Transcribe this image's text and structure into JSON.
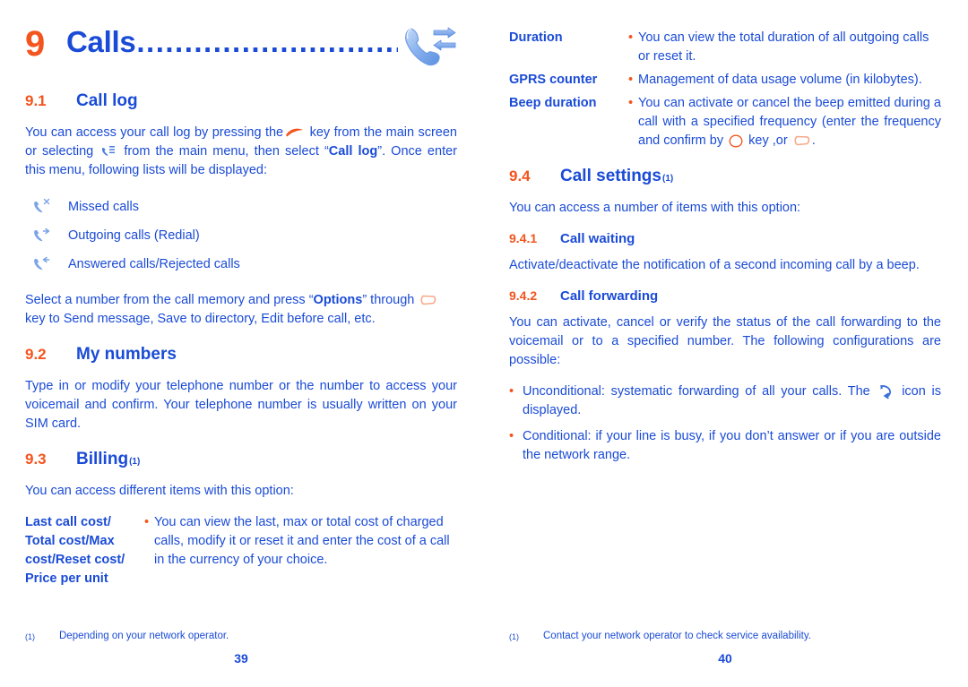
{
  "document": {
    "type": "mobile-phone-user-manual-spread"
  },
  "colors": {
    "heading_blue": "#1a4bd6",
    "accent_orange": "#f4541d",
    "body_blue": "#1a4bd6",
    "page_background": "#ffffff"
  },
  "left_page": {
    "chapter": {
      "number": "9",
      "title": "Calls",
      "dot_leader": "..................................",
      "icon": "phone-call-exchange-icon"
    },
    "section_9_1": {
      "number": "9.1",
      "title": "Call log",
      "intro_part1": "You can access your call log by pressing the",
      "intro_icon1": "send-key-icon",
      "intro_part2": "key from the main screen or selecting",
      "intro_icon2": "call-log-menu-icon",
      "intro_part3": "from the main menu, then select “",
      "intro_bold": "Call log",
      "intro_part4": "”. Once enter this menu, following lists will be displayed:",
      "list": [
        {
          "icon": "missed-call-icon",
          "label": "Missed calls"
        },
        {
          "icon": "outgoing-call-icon",
          "label": "Outgoing calls (Redial)"
        },
        {
          "icon": "answered-call-icon",
          "label": "Answered calls/Rejected calls"
        }
      ],
      "outro_part1": "Select a number from the call memory and press “",
      "outro_bold": "Options",
      "outro_part2": "” through",
      "outro_icon": "soft-key-icon",
      "outro_part3": "key to Send message, Save to directory, Edit before call, etc."
    },
    "section_9_2": {
      "number": "9.2",
      "title": "My numbers",
      "body": "Type in or modify your telephone number or the number to access your voicemail and confirm. Your telephone number is usually written on your SIM card."
    },
    "section_9_3": {
      "number": "9.3",
      "title": "Billing",
      "footnote_mark": "(1)",
      "intro": "You can access different items with this option:",
      "rows": [
        {
          "term_lines": [
            "Last call cost/",
            "Total cost/Max",
            "cost/Reset cost/",
            "Price per unit"
          ],
          "bullet": "•",
          "desc": "You can view the last, max or total cost of charged calls, modify it or reset it and enter the cost of a call in the currency of your choice."
        }
      ]
    },
    "footnote": {
      "mark": "(1)",
      "text": "Depending on your network operator."
    },
    "page_number": "39"
  },
  "right_page": {
    "billing_continued": {
      "rows": [
        {
          "term": "Duration",
          "bullet": "•",
          "desc": "You can view the total duration of all outgoing calls or reset it."
        },
        {
          "term": "GPRS counter",
          "bullet": "•",
          "desc": "Management of data usage volume (in kilobytes)."
        },
        {
          "term": "Beep duration",
          "bullet": "•",
          "desc_part1": "You can activate or cancel the beep emitted during a call with a specified frequency (enter the frequency and confirm by",
          "desc_icon1": "ok-key-icon",
          "desc_part2": "key ,or",
          "desc_icon2": "soft-key-icon",
          "desc_part3": "."
        }
      ]
    },
    "section_9_4": {
      "number": "9.4",
      "title": "Call settings",
      "footnote_mark": "(1)",
      "intro": "You can access a number of items with this option:",
      "sub_9_4_1": {
        "number": "9.4.1",
        "title": "Call waiting",
        "body": "Activate/deactivate the notification of a second incoming call by a beep."
      },
      "sub_9_4_2": {
        "number": "9.4.2",
        "title": "Call forwarding",
        "body": "You can activate, cancel or verify the status of the call forwarding to the voicemail or to a specified number. The following configurations are possible:",
        "bullets": [
          {
            "dot": "•",
            "part1": "Unconditional: systematic forwarding of all your calls. The",
            "icon": "call-forward-icon",
            "part2": "icon is displayed."
          },
          {
            "dot": "•",
            "part1": "Conditional: if your line is busy, if you don’t answer or if you are outside the network range.",
            "icon": null,
            "part2": ""
          }
        ]
      }
    },
    "footnote": {
      "mark": "(1)",
      "text": "Contact your network operator to check service availability."
    },
    "page_number": "40"
  }
}
